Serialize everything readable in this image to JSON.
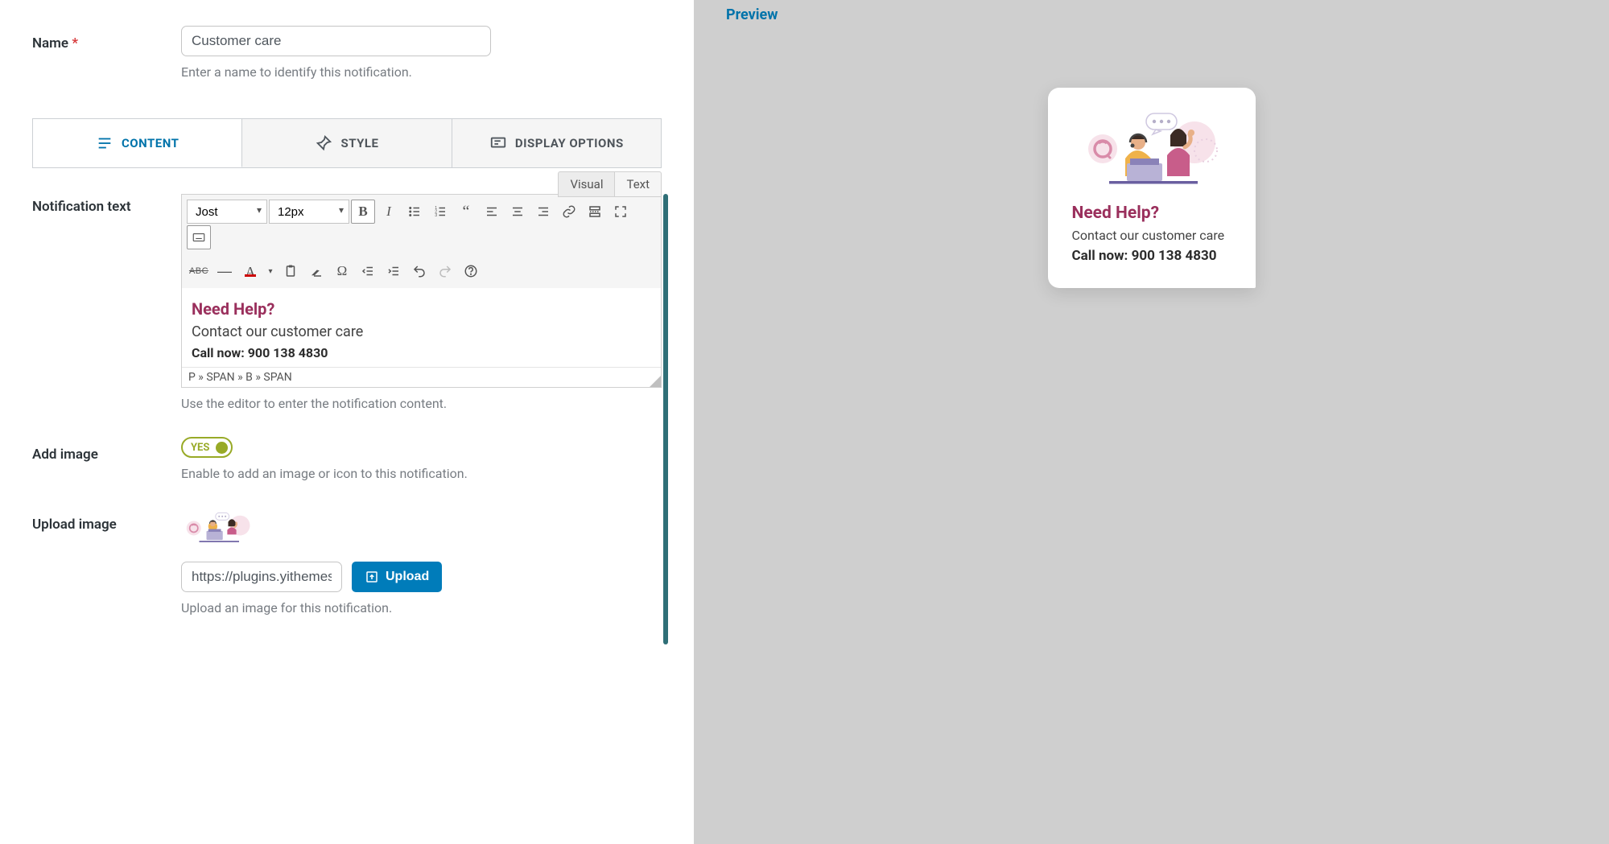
{
  "name_field": {
    "label": "Name",
    "required_mark": "*",
    "value": "Customer care",
    "helper": "Enter a name to identify this notification."
  },
  "tabs": {
    "content": "CONTENT",
    "style": "STYLE",
    "display": "DISPLAY OPTIONS"
  },
  "editor": {
    "label": "Notification text",
    "mode_visual": "Visual",
    "mode_text": "Text",
    "font": "Jost",
    "size": "12px",
    "heading": "Need Help?",
    "subtext": "Contact our customer care",
    "call": "Call now: 900 138 4830",
    "path": "P » SPAN » B » SPAN",
    "helper": "Use the editor to enter the notification content."
  },
  "add_image": {
    "label": "Add image",
    "toggle_text": "YES",
    "helper": "Enable to add an image or icon to this notification."
  },
  "upload": {
    "label": "Upload image",
    "url_value": "https://plugins.yithemes.com/",
    "button": "Upload",
    "helper": "Upload an image for this notification."
  },
  "preview": {
    "title": "Preview",
    "card_heading": "Need Help?",
    "card_sub": "Contact our customer care",
    "card_call": "Call now: 900 138 4830"
  }
}
